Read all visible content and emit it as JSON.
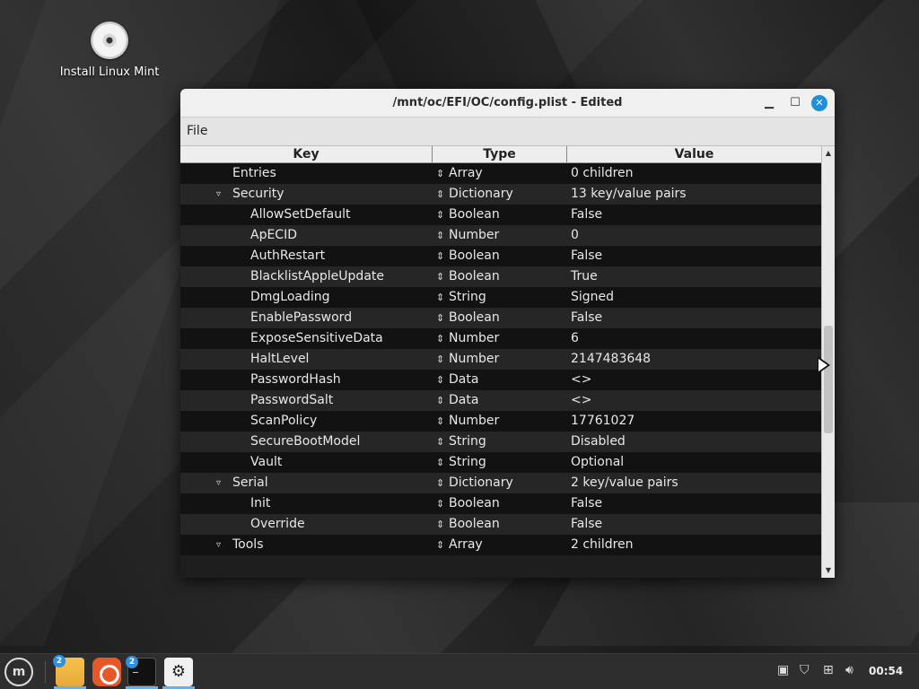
{
  "desktop": {
    "icon_label": "Install Linux Mint"
  },
  "window": {
    "title": "/mnt/oc/EFI/OC/config.plist - Edited",
    "menu": {
      "file": "File"
    }
  },
  "table": {
    "headers": {
      "key": "Key",
      "type": "Type",
      "value": "Value"
    },
    "rows": [
      {
        "key": "Entries",
        "type": "Array",
        "value": "0 children",
        "indent": 1,
        "expanded": null
      },
      {
        "key": "Security",
        "type": "Dictionary",
        "value": "13 key/value pairs",
        "indent": 1,
        "expanded": true
      },
      {
        "key": "AllowSetDefault",
        "type": "Boolean",
        "value": "False",
        "indent": 2,
        "expanded": null
      },
      {
        "key": "ApECID",
        "type": "Number",
        "value": "0",
        "indent": 2,
        "expanded": null
      },
      {
        "key": "AuthRestart",
        "type": "Boolean",
        "value": "False",
        "indent": 2,
        "expanded": null
      },
      {
        "key": "BlacklistAppleUpdate",
        "type": "Boolean",
        "value": "True",
        "indent": 2,
        "expanded": null
      },
      {
        "key": "DmgLoading",
        "type": "String",
        "value": "Signed",
        "indent": 2,
        "expanded": null
      },
      {
        "key": "EnablePassword",
        "type": "Boolean",
        "value": "False",
        "indent": 2,
        "expanded": null
      },
      {
        "key": "ExposeSensitiveData",
        "type": "Number",
        "value": "6",
        "indent": 2,
        "expanded": null
      },
      {
        "key": "HaltLevel",
        "type": "Number",
        "value": "2147483648",
        "indent": 2,
        "expanded": null
      },
      {
        "key": "PasswordHash",
        "type": "Data",
        "value": "<>",
        "indent": 2,
        "expanded": null
      },
      {
        "key": "PasswordSalt",
        "type": "Data",
        "value": "<>",
        "indent": 2,
        "expanded": null
      },
      {
        "key": "ScanPolicy",
        "type": "Number",
        "value": "17761027",
        "indent": 2,
        "expanded": null
      },
      {
        "key": "SecureBootModel",
        "type": "String",
        "value": "Disabled",
        "indent": 2,
        "expanded": null
      },
      {
        "key": "Vault",
        "type": "String",
        "value": "Optional",
        "indent": 2,
        "expanded": null
      },
      {
        "key": "Serial",
        "type": "Dictionary",
        "value": "2 key/value pairs",
        "indent": 1,
        "expanded": true
      },
      {
        "key": "Init",
        "type": "Boolean",
        "value": "False",
        "indent": 2,
        "expanded": null
      },
      {
        "key": "Override",
        "type": "Boolean",
        "value": "False",
        "indent": 2,
        "expanded": null
      },
      {
        "key": "Tools",
        "type": "Array",
        "value": "2 children",
        "indent": 1,
        "expanded": true
      }
    ],
    "type_glyph": "⇕",
    "expanded_glyph": "▿"
  },
  "taskbar": {
    "badges": {
      "files": "2",
      "terminal": "2"
    },
    "clock": "00:54",
    "icons": [
      "menu-icon",
      "folder-icon",
      "firefox-icon",
      "terminal-icon",
      "settings-icon",
      "clipboard-icon",
      "shield-icon",
      "network-icon",
      "volume-icon"
    ]
  }
}
